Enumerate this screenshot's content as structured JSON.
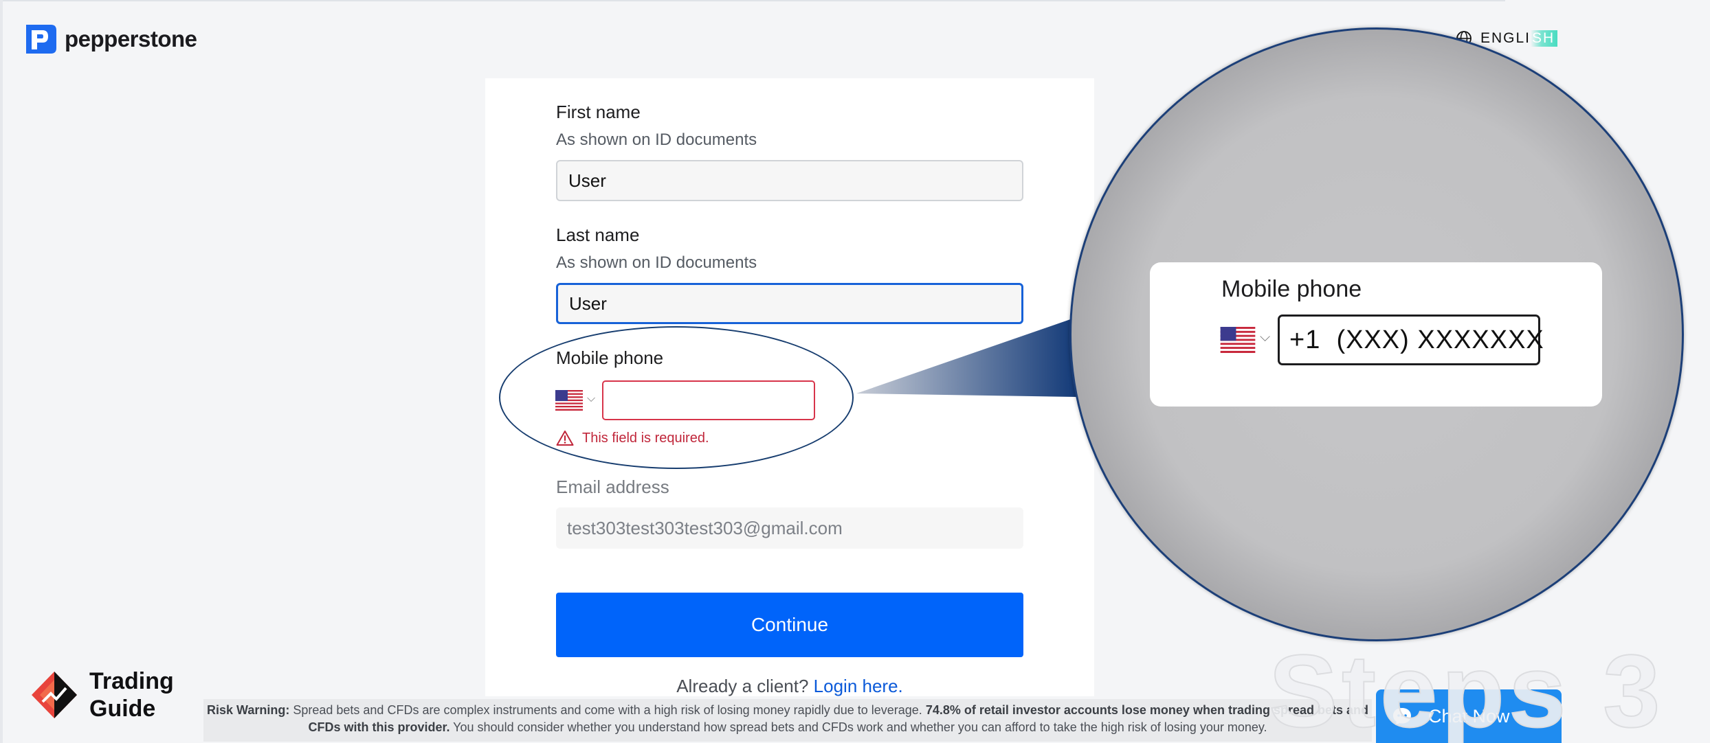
{
  "header": {
    "brand": "pepperstone",
    "language_prefix": "ENGLI",
    "language_suffix": "SH"
  },
  "form": {
    "first_name": {
      "label": "First name",
      "help": "As shown on ID documents",
      "value": "User"
    },
    "last_name": {
      "label": "Last name",
      "help": "As shown on ID documents",
      "value": "User"
    },
    "mobile_phone": {
      "label": "Mobile phone",
      "value": "",
      "error": "This field is required."
    },
    "email": {
      "label": "Email address",
      "value": "test303test303test303@gmail.com"
    },
    "continue_label": "Continue",
    "already_text": "Already a client?",
    "login_link": "Login here."
  },
  "zoom": {
    "label": "Mobile phone",
    "placeholder": "+1  (XXX) XXXXXXX"
  },
  "trading_guide": {
    "line1": "Trading",
    "line2": "Guide"
  },
  "risk_warning": {
    "lead": "Risk Warning:",
    "text1": " Spread bets and CFDs are complex instruments and come with a high risk of losing money rapidly due to leverage. ",
    "bold": "74.8% of retail investor accounts lose money when trading spread bets and CFDs with this provider.",
    "text2": " You should consider whether you understand how spread bets and CFDs work and whether you can afford to take the high risk of losing your money."
  },
  "watermark": "Steps 3",
  "chat": {
    "label": "Chat Now"
  },
  "colors": {
    "brand_blue": "#0064fa",
    "error_red": "#d7344a",
    "focus_blue": "#1762d8"
  }
}
